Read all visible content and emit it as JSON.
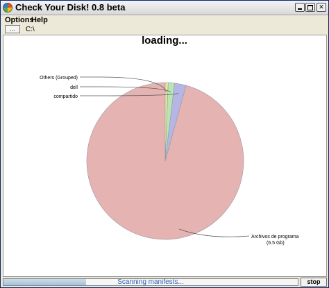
{
  "window": {
    "title": "Check Your Disk! 0.8 beta",
    "minimize_label": "",
    "maximize_label": "",
    "close_label": "✕"
  },
  "menu": {
    "options_label": "Options",
    "help_label": "Help"
  },
  "path": {
    "browse_label": "...",
    "current": "C:\\"
  },
  "main": {
    "loading_text": "loading..."
  },
  "chart_data": {
    "type": "pie",
    "title": "loading...",
    "units": "GB",
    "slices": [
      {
        "label": "Archivos de programa",
        "sublabel": "(6.5 Gb)",
        "fraction": 0.957,
        "color": "#e6b3b3"
      },
      {
        "label": "compartido",
        "sublabel": "",
        "fraction": 0.024,
        "color": "#b5b5e6"
      },
      {
        "label": "dell",
        "sublabel": "",
        "fraction": 0.013,
        "color": "#b8e6b0"
      },
      {
        "label": "Others (Grouped)",
        "sublabel": "",
        "fraction": 0.006,
        "color": "#e6e6a0"
      }
    ],
    "legend": "none"
  },
  "status": {
    "text": "Scanning manifests...",
    "progress": 0.28,
    "stop_label": "stop"
  }
}
